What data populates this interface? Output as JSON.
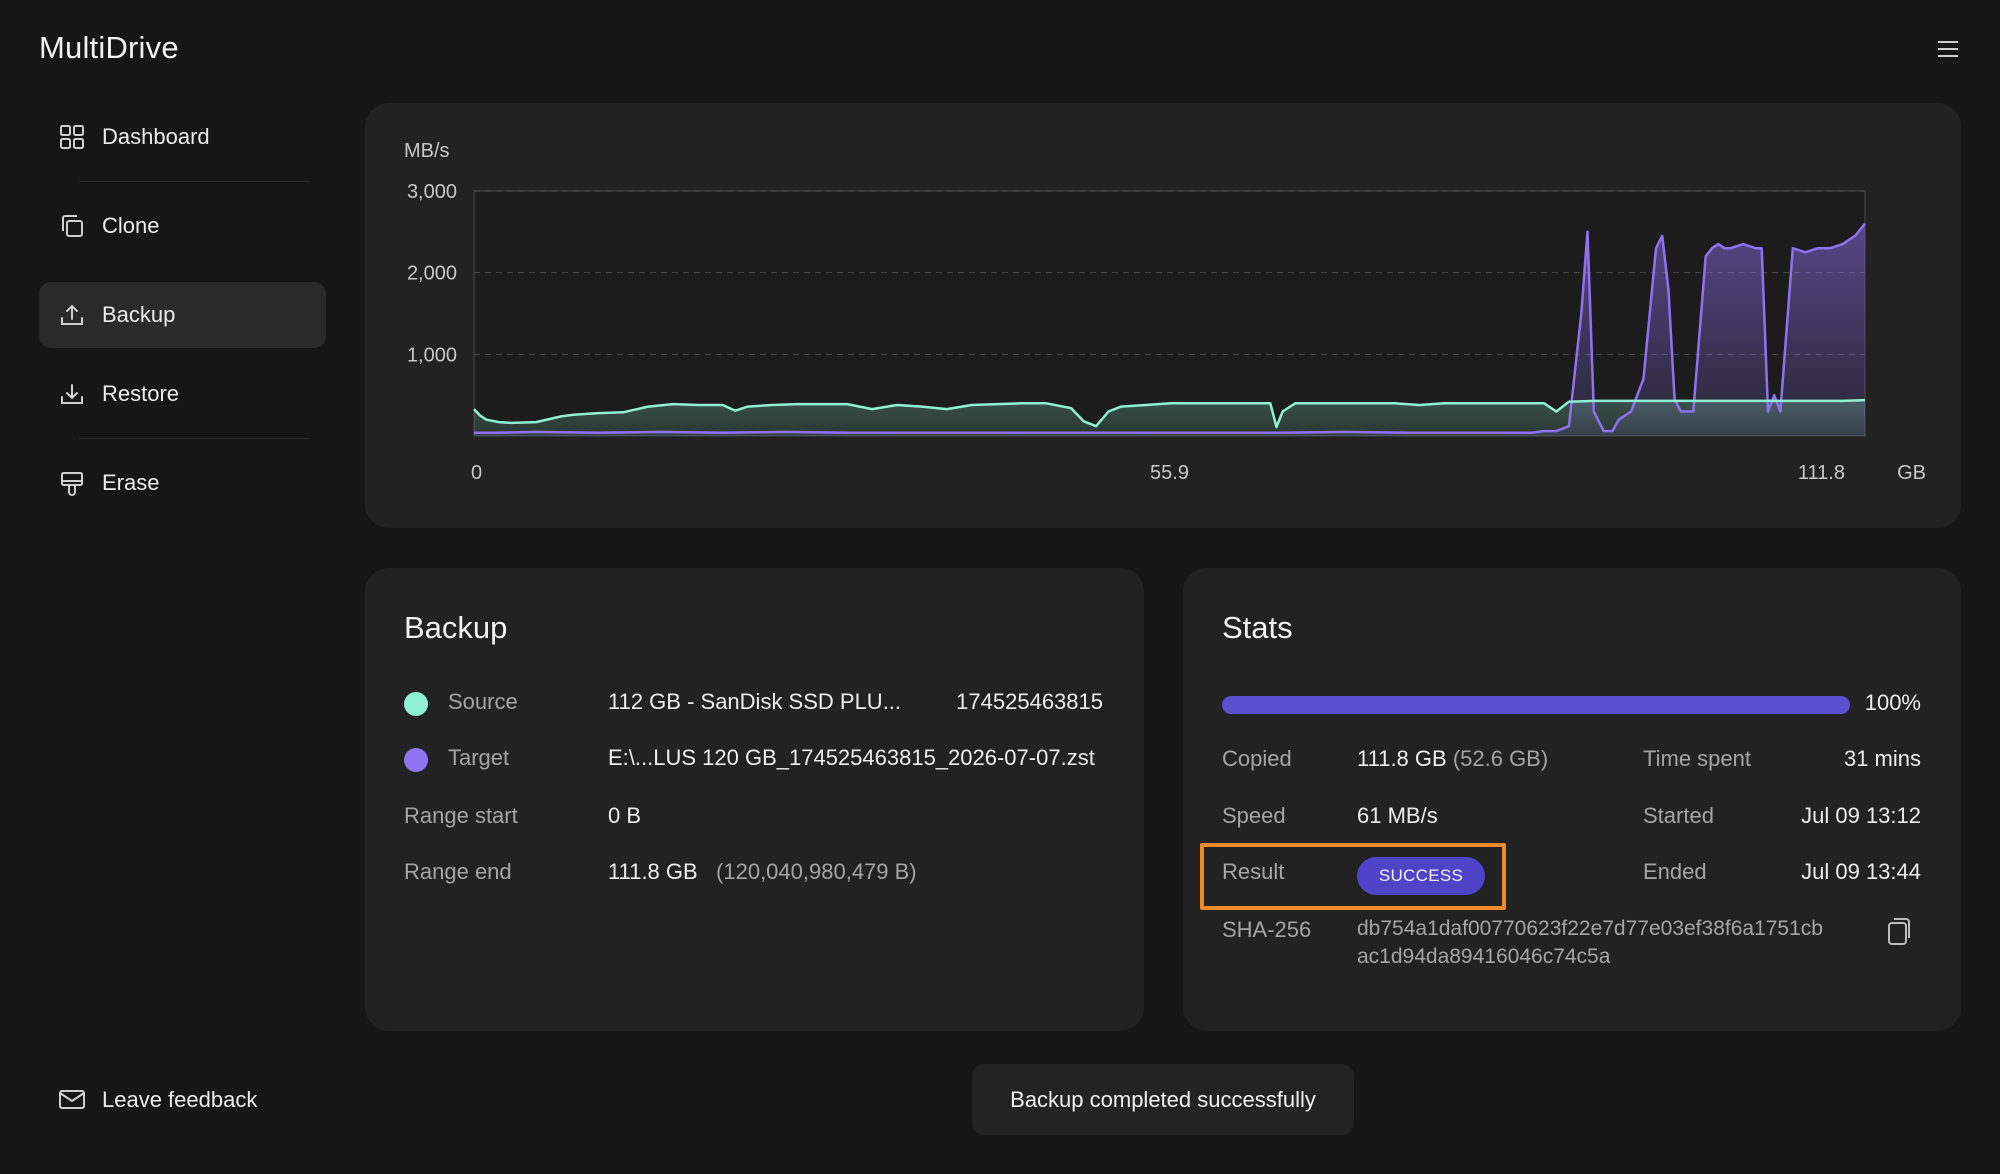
{
  "app": {
    "title": "MultiDrive"
  },
  "sidebar": {
    "items": [
      {
        "label": "Dashboard",
        "icon": "dashboard-icon"
      },
      {
        "label": "Clone",
        "icon": "clone-icon"
      },
      {
        "label": "Backup",
        "icon": "upload-icon",
        "active": true
      },
      {
        "label": "Restore",
        "icon": "download-icon"
      },
      {
        "label": "Erase",
        "icon": "erase-icon"
      }
    ],
    "feedback_label": "Leave feedback"
  },
  "chart_data": {
    "type": "line",
    "ylabel": "MB/s",
    "xlabel": "GB",
    "ylim": [
      0,
      3000
    ],
    "yticks": [
      "1,000",
      "2,000",
      "3,000"
    ],
    "xticks": [
      "0",
      "55.9",
      "111.8"
    ],
    "xlim": [
      0,
      111.8
    ],
    "grid": true,
    "series": [
      {
        "color": "#8ff0d2",
        "x": [
          0,
          0.5,
          1,
          2,
          3,
          5,
          7,
          8,
          10,
          12,
          14,
          16,
          18,
          20,
          21,
          22,
          24,
          26,
          28,
          30,
          32,
          34,
          36,
          38,
          40,
          42,
          44,
          46,
          48,
          49,
          50,
          51,
          52,
          54,
          56,
          58,
          60,
          62,
          64,
          64.5,
          65,
          66,
          68,
          70,
          72,
          74,
          76,
          78,
          80,
          82,
          84,
          86,
          87,
          88,
          90,
          92,
          94,
          96,
          98,
          100,
          102,
          104,
          106,
          108,
          110,
          111.8
        ],
        "y": [
          330,
          250,
          200,
          170,
          160,
          170,
          240,
          260,
          280,
          290,
          360,
          390,
          380,
          380,
          310,
          360,
          380,
          390,
          390,
          390,
          330,
          380,
          360,
          330,
          380,
          390,
          400,
          400,
          340,
          180,
          120,
          300,
          360,
          380,
          400,
          400,
          400,
          400,
          400,
          110,
          300,
          400,
          400,
          400,
          400,
          400,
          380,
          400,
          400,
          400,
          400,
          400,
          300,
          420,
          430,
          430,
          430,
          430,
          430,
          430,
          430,
          430,
          430,
          430,
          430,
          440
        ]
      },
      {
        "color": "#8e72f0",
        "x": [
          0,
          2,
          5,
          10,
          15,
          20,
          25,
          30,
          35,
          40,
          45,
          50,
          55,
          60,
          65,
          70,
          75,
          80,
          85,
          86,
          87,
          88,
          89,
          89.5,
          90,
          90.8,
          91,
          91.5,
          92,
          93,
          94,
          95,
          95.5,
          96,
          96.5,
          97,
          97.5,
          98,
          99,
          99.5,
          100,
          100.5,
          101,
          102,
          103,
          103.5,
          104,
          104.5,
          105,
          106,
          107,
          108,
          109,
          110,
          111,
          111.8
        ],
        "y": [
          40,
          40,
          50,
          40,
          50,
          40,
          50,
          40,
          40,
          40,
          40,
          40,
          40,
          40,
          40,
          50,
          40,
          40,
          40,
          60,
          60,
          120,
          1500,
          2500,
          300,
          60,
          60,
          60,
          200,
          300,
          700,
          2300,
          2450,
          1800,
          450,
          300,
          300,
          300,
          2200,
          2300,
          2350,
          2300,
          2300,
          2350,
          2300,
          2300,
          300,
          500,
          300,
          2300,
          2250,
          2300,
          2300,
          2350,
          2450,
          2600
        ]
      }
    ]
  },
  "backup": {
    "title": "Backup",
    "source": {
      "label": "Source",
      "value": "112 GB - SanDisk SSD PLU...",
      "serial": "174525463815",
      "color": "#8ff0d2"
    },
    "target": {
      "label": "Target",
      "value": "E:\\...LUS 120 GB_174525463815_2026-07-07.zst",
      "color": "#8e72f0"
    },
    "range_start": {
      "label": "Range start",
      "value": "0 B"
    },
    "range_end": {
      "label": "Range end",
      "value": "111.8 GB",
      "bytes": "(120,040,980,479 B)"
    }
  },
  "stats": {
    "title": "Stats",
    "progress": 1.0,
    "progress_label": "100%",
    "copied": {
      "label": "Copied",
      "value": "111.8 GB",
      "compressed": "(52.6 GB)"
    },
    "speed": {
      "label": "Speed",
      "value": "61 MB/s"
    },
    "result": {
      "label": "Result",
      "value": "SUCCESS"
    },
    "sha": {
      "label": "SHA-256",
      "line1": "db754a1daf00770623f22e7d77e03ef38f6a1751cb",
      "line2": "ac1d94da89416046c74c5a"
    },
    "time_spent": {
      "label": "Time spent",
      "value": "31 mins"
    },
    "started": {
      "label": "Started",
      "value": "Jul 09 13:12"
    },
    "ended": {
      "label": "Ended",
      "value": "Jul 09 13:44"
    }
  },
  "toast": {
    "message": "Backup completed successfully"
  },
  "colors": {
    "accent": "#5b4fd0",
    "highlight": "#f28a2a"
  }
}
